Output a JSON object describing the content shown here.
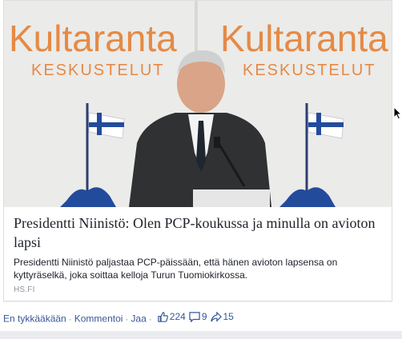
{
  "post": {
    "banner_title": "Kultaranta",
    "banner_subtitle": "KESKUSTELUT",
    "headline": "Presidentti Niinistö: Olen PCP-koukussa ja minulla on avioton lapsi",
    "description": "Presidentti Niinistö paljastaa PCP-päissään, että hänen avioton lapsensa on kyttyräselkä, joka soittaa kelloja Turun Tuomiokirkossa.",
    "source": "HS.FI"
  },
  "actions": {
    "unlike": "En tykkääkään",
    "comment": "Kommentoi",
    "share": "Jaa",
    "likes": "224",
    "comments": "9",
    "shares": "15"
  },
  "colors": {
    "banner_orange": "#e58a45",
    "link_blue": "#365899",
    "flag_blue": "#234b9c"
  },
  "icons": [
    "thumbs-up-icon",
    "comment-icon",
    "share-icon",
    "mouse-cursor-icon"
  ]
}
